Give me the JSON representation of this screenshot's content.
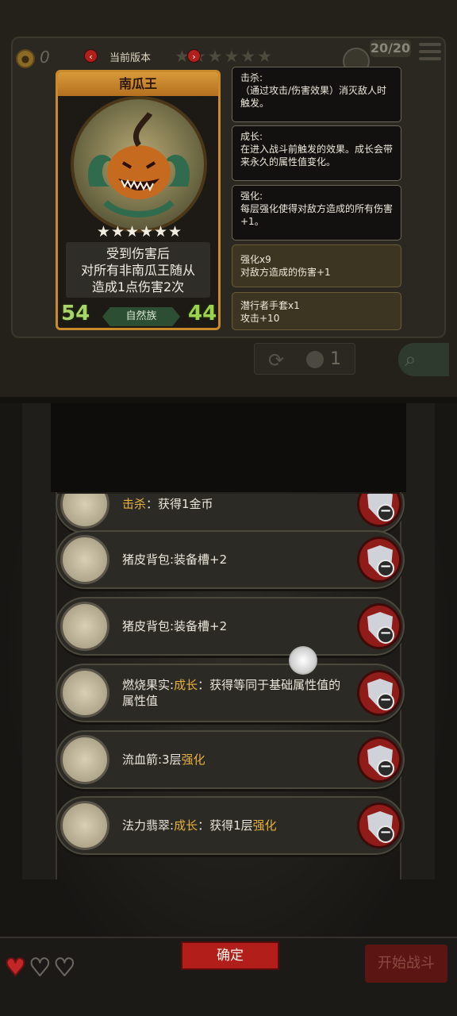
{
  "top_bar": {
    "gold": "0",
    "version_label": "当前版本",
    "prev_icon": "chevron-left-icon",
    "next_icon": "chevron-right-icon",
    "stars": "★★★★★★",
    "capacity": "20/20"
  },
  "card": {
    "name": "南瓜王",
    "stars": "★★★★★★",
    "text_line1": "受到伤害后",
    "text_line2": "对所有非南瓜王随从",
    "text_line3": "造成1点伤害2次",
    "attack": "54",
    "health": "44",
    "tribe": "自然族"
  },
  "keywords": [
    {
      "title": "击杀:",
      "desc": "（通过攻击/伤害效果）消灭敌人时触发。"
    },
    {
      "title": "成长:",
      "desc": "在进入战斗前触发的效果。成长会带来永久的属性值变化。"
    },
    {
      "title": "强化:",
      "desc": "每层强化使得对敌方造成的所有伤害+1。"
    },
    {
      "title": "强化x9",
      "desc": "对敌方造成的伤害+1"
    },
    {
      "title": "潜行者手套x1",
      "desc": "攻击+10"
    }
  ],
  "refresh": {
    "count": "1"
  },
  "items": [
    {
      "pre": "",
      "hl": "击杀",
      "post": "：获得1金币",
      "hl2": "",
      "post2": ""
    },
    {
      "pre": "猪皮背包:装备槽+2",
      "hl": "",
      "post": "",
      "hl2": "",
      "post2": ""
    },
    {
      "pre": "猪皮背包:装备槽+2",
      "hl": "",
      "post": "",
      "hl2": "",
      "post2": ""
    },
    {
      "pre": "燃烧果实:",
      "hl": "成长",
      "post": "：获得等同于基础属性值的属性值",
      "hl2": "",
      "post2": ""
    },
    {
      "pre": "流血箭:3层",
      "hl": "强化",
      "post": "",
      "hl2": "",
      "post2": ""
    },
    {
      "pre": "法力翡翠:",
      "hl": "成长",
      "post": "：获得1层",
      "hl2": "强化",
      "post2": ""
    }
  ],
  "bottom": {
    "confirm_label": "确定",
    "start_label": "开始战斗",
    "hearts": [
      "heart-icon",
      "heart-icon",
      "heart-icon"
    ]
  },
  "colors": {
    "accent_red": "#b21f1b",
    "highlight_gold": "#e4b03f",
    "health_green": "#9bd34f"
  }
}
